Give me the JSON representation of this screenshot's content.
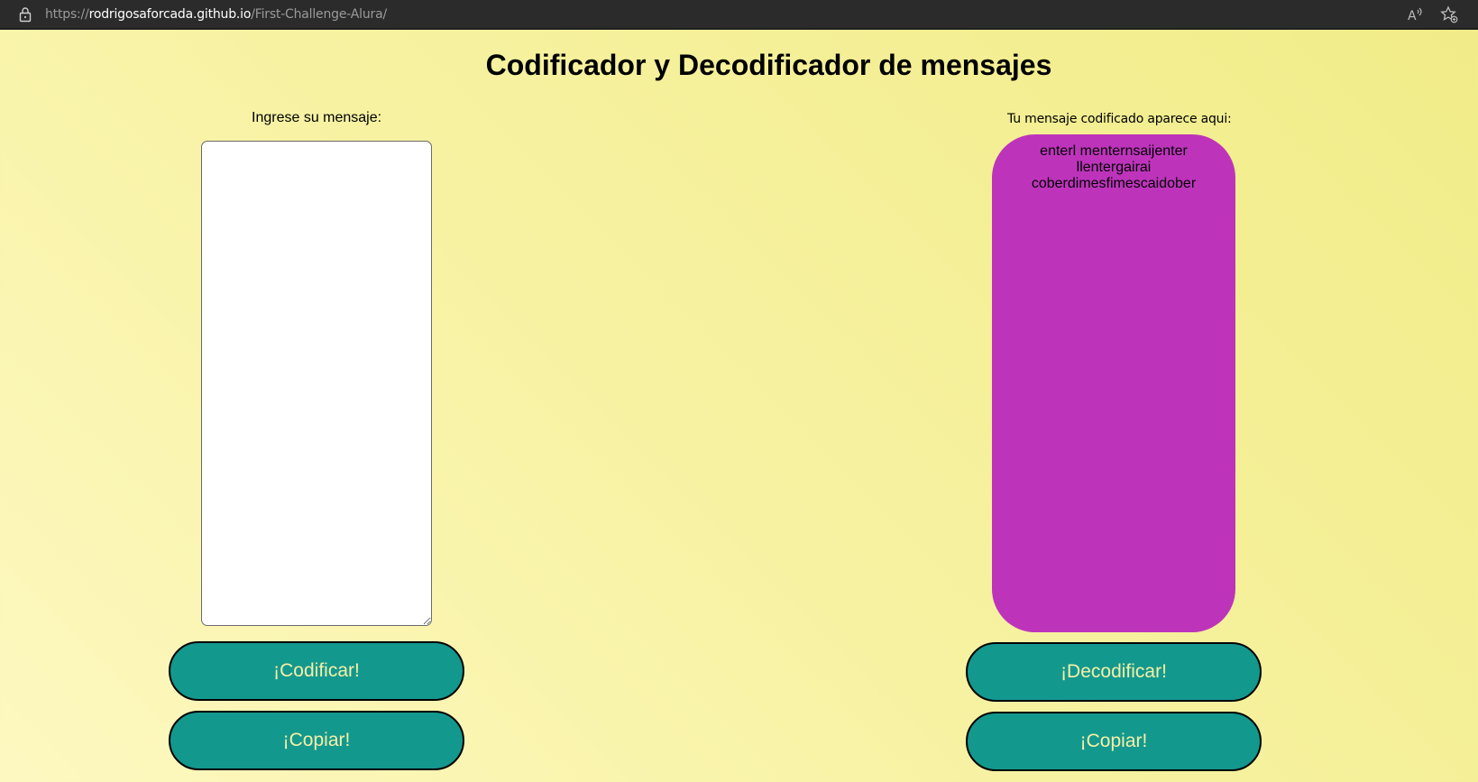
{
  "browser": {
    "url_scheme": "https://",
    "url_host": "rodrigosaforcada.github.io",
    "url_path": "/First-Challenge-Alura/",
    "icons": [
      "lock-icon",
      "read-aloud-icon",
      "favorites-icon"
    ]
  },
  "page": {
    "title": "Codificador y Decodificador de mensajes"
  },
  "input_panel": {
    "label": "Ingrese su mensaje:",
    "value": "",
    "encode_button": "¡Codificar!",
    "copy_button": "¡Copiar!"
  },
  "output_panel": {
    "label": "Tu mensaje codificado aparece aqui:",
    "lines": [
      "enterl menternsaijenter",
      "llentergairai",
      "coberdimesfimescaidober"
    ],
    "decode_button": "¡Decodificar!",
    "copy_button": "¡Copiar!"
  },
  "colors": {
    "background": "#f7f2a2",
    "output_box": "#bd34bb",
    "button_bg": "#13988e",
    "button_text": "#f6f0a6",
    "browser_bar": "#2b2b2b"
  }
}
